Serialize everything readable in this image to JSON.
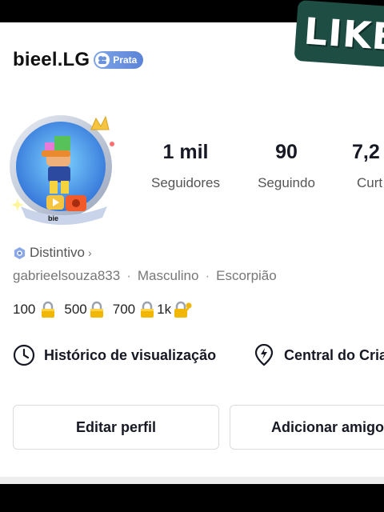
{
  "profile": {
    "username": "bieel.LG",
    "badge_label": "Prata",
    "distintivo_label": "Distintivo",
    "handle": "gabrieelsouza833",
    "gender": "Masculino",
    "sign": "Escorpião",
    "info_separator": "·"
  },
  "sticker": {
    "text": "LIKE"
  },
  "stats": [
    {
      "value": "1 mil",
      "label": "Seguidores"
    },
    {
      "value": "90",
      "label": "Seguindo"
    },
    {
      "value": "7,2",
      "label": "Curt"
    }
  ],
  "goals": [
    "100",
    "500",
    "700",
    "1k"
  ],
  "links": {
    "history": "Histórico de visualização",
    "creator": "Central do Cria"
  },
  "buttons": {
    "edit": "Editar perfil",
    "add": "Adicionar amigo"
  },
  "avatar": {
    "tag_text": "bie"
  },
  "colors": {
    "badge": "#6b93dd",
    "sticker": "#1e4d44",
    "divider": "#eeeeee"
  }
}
